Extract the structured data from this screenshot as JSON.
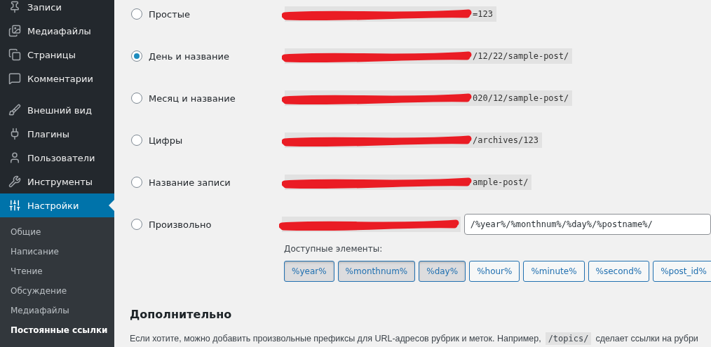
{
  "sidebar": {
    "menu_groups": [
      [
        {
          "label": "Записи",
          "selected": false
        },
        {
          "label": "Медиафайлы",
          "selected": false
        },
        {
          "label": "Страницы",
          "selected": false
        },
        {
          "label": "Комментарии",
          "selected": false
        }
      ],
      [
        {
          "label": "Внешний вид",
          "selected": false
        },
        {
          "label": "Плагины",
          "selected": false
        },
        {
          "label": "Пользователи",
          "selected": false
        },
        {
          "label": "Инструменты",
          "selected": false
        },
        {
          "label": "Настройки",
          "selected": true
        }
      ]
    ],
    "submenu": [
      {
        "label": "Общие",
        "selected": false
      },
      {
        "label": "Написание",
        "selected": false
      },
      {
        "label": "Чтение",
        "selected": false
      },
      {
        "label": "Обсуждение",
        "selected": false
      },
      {
        "label": "Медиафайлы",
        "selected": false
      },
      {
        "label": "Постоянные ссылки",
        "selected": true
      }
    ]
  },
  "permalink_options": [
    {
      "kind": "preset",
      "label": "Простые",
      "selected": false,
      "example": "=123"
    },
    {
      "kind": "preset",
      "label": "День и название",
      "selected": true,
      "example": "/12/22/sample-post/"
    },
    {
      "kind": "preset",
      "label": "Месяц и название",
      "selected": false,
      "example": "020/12/sample-post/"
    },
    {
      "kind": "preset",
      "label": "Цифры",
      "selected": false,
      "example": "/archives/123"
    },
    {
      "kind": "preset",
      "label": "Название записи",
      "selected": false,
      "example": "ample-post/"
    },
    {
      "kind": "custom",
      "label": "Произвольно",
      "selected": false,
      "value": "/%year%/%monthnum%/%day%/%postname%/"
    }
  ],
  "available_tags_label": "Доступные элементы:",
  "tags": [
    {
      "label": "%year%",
      "selected": true
    },
    {
      "label": "%monthnum%",
      "selected": true
    },
    {
      "label": "%day%",
      "selected": true
    },
    {
      "label": "%hour%",
      "selected": false
    },
    {
      "label": "%minute%",
      "selected": false
    },
    {
      "label": "%second%",
      "selected": false
    },
    {
      "label": "%post_id%",
      "selected": false
    }
  ],
  "optional_section": {
    "heading": "Дополнительно",
    "text_before": "Если хотите, можно добавить произвольные префиксы для URL-адресов рубрик и меток. Например,",
    "code": "/topics/",
    "text_after": "сделает ссылки на рубри"
  }
}
